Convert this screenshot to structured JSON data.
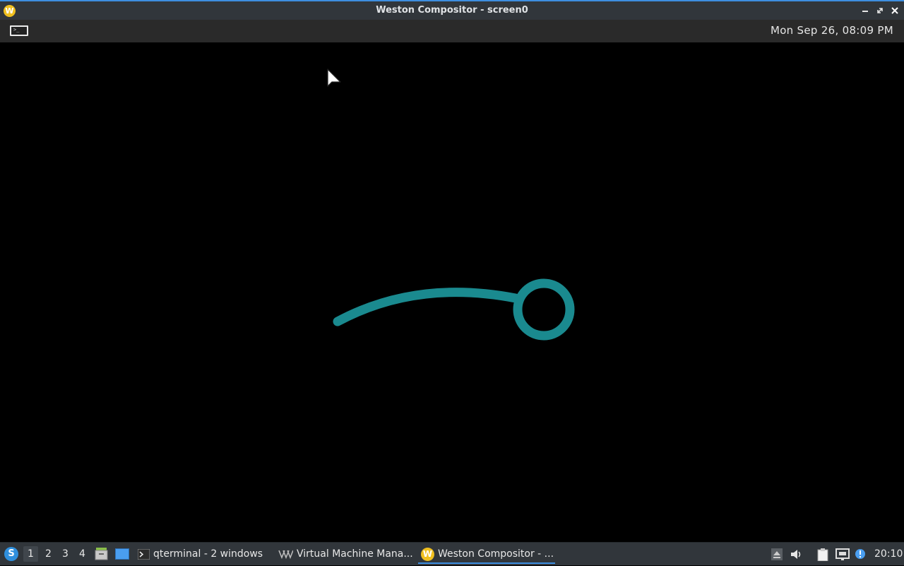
{
  "window": {
    "title": "Weston Compositor - screen0",
    "logo_letter": "W",
    "controls": {
      "minimize": "minimize-icon",
      "maximize": "maximize-icon",
      "close": "close-icon"
    }
  },
  "panel": {
    "launcher_icon": "terminal-icon",
    "clock": "Mon Sep 26, 08:09 PM"
  },
  "canvas": {
    "flower_color": "#1a8a8f",
    "cursor_icon": "pointer-cursor-icon"
  },
  "taskbar": {
    "start_icon": "lxqt-start-icon",
    "start_letter": "S",
    "desktops": [
      "1",
      "2",
      "3",
      "4"
    ],
    "active_desktop": "1",
    "quicklaunch": [
      "file-manager-icon",
      "show-desktop-icon"
    ],
    "tasks": [
      {
        "label": "qterminal - 2 windows",
        "icon": "terminal-icon"
      },
      {
        "label": "Virtual Machine Mana...",
        "icon": "virt-manager-icon"
      },
      {
        "label": "Weston Compositor - ...",
        "icon": "weston-icon",
        "logo_letter": "W",
        "active": true
      }
    ],
    "tray": [
      "eject-icon",
      "volume-icon",
      "clipboard-icon",
      "network-icon",
      "notification-icon"
    ],
    "clock": "20:10"
  },
  "colors": {
    "accent": "#3d8ee0",
    "panel_bg": "#2a2a2a",
    "taskbar_bg": "#31363b"
  }
}
